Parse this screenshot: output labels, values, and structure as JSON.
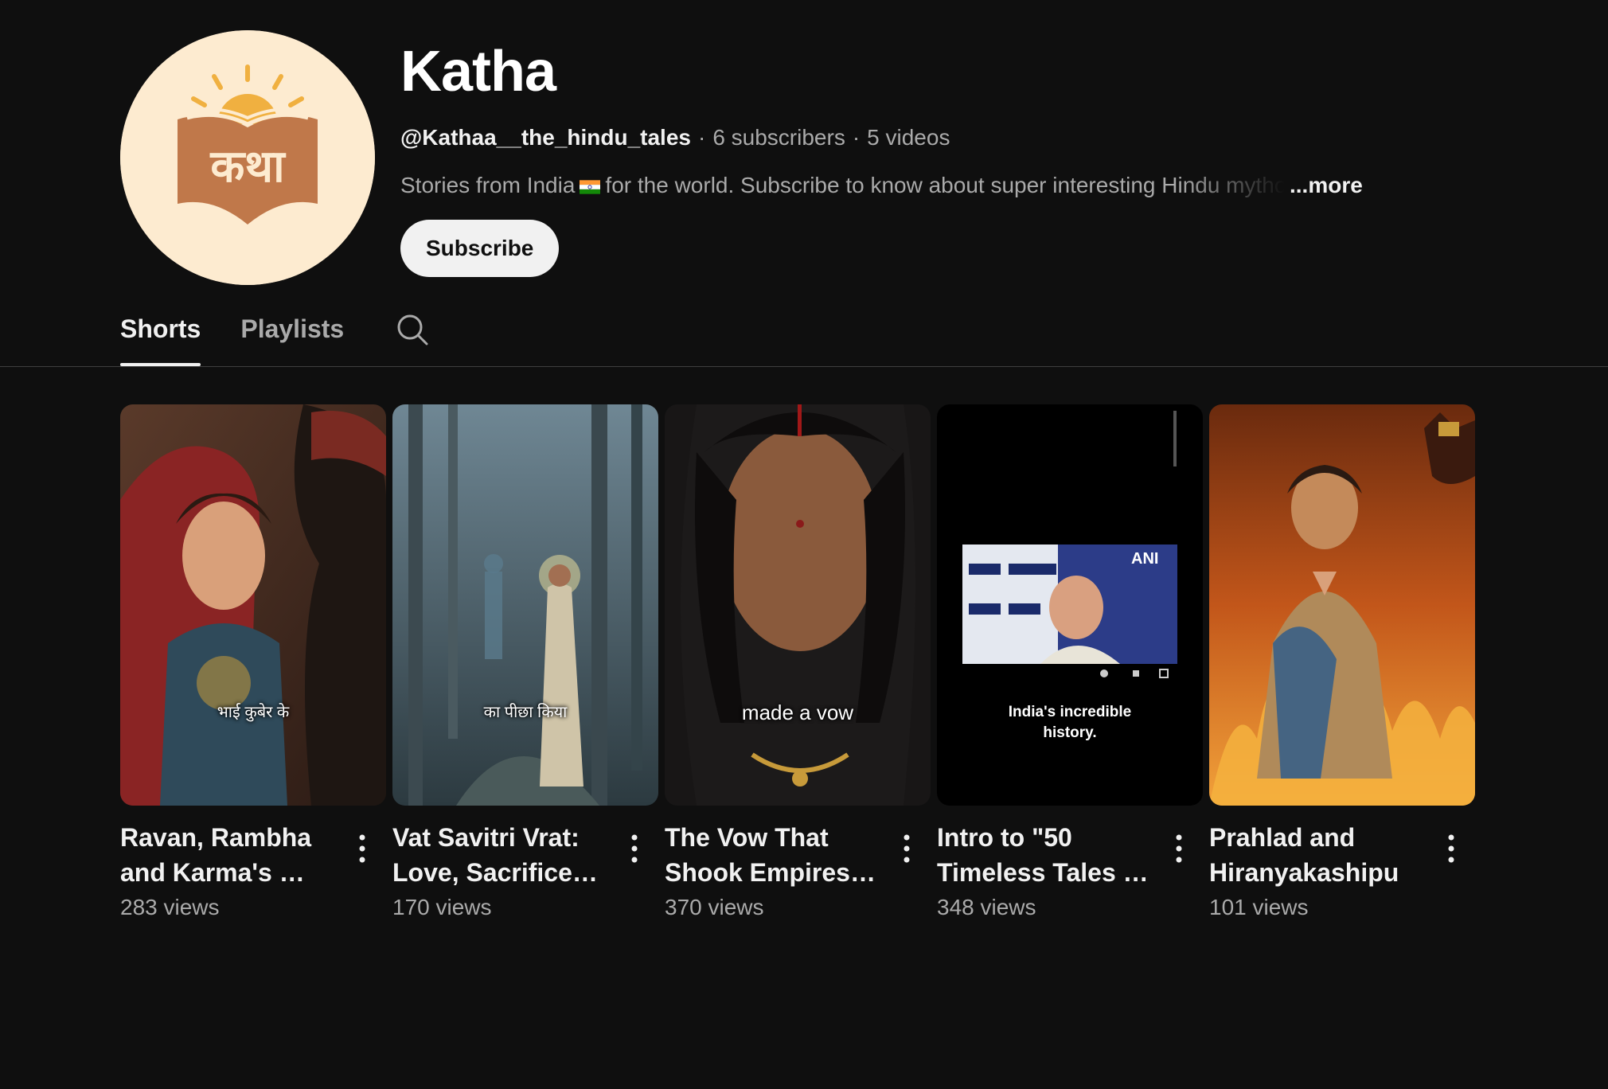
{
  "channel": {
    "title": "Katha",
    "avatar_text": "कथा",
    "handle": "@Kathaa__the_hindu_tales",
    "subscribers": "6 subscribers",
    "videos": "5 videos",
    "separator": "·",
    "description_before_flag": "Stories from India",
    "description_after_flag": "for the world. Subscribe to know about super interesting Hindu mythology",
    "more_label": "...more",
    "subscribe_label": "Subscribe",
    "flag_icon": "india-flag-icon"
  },
  "tabs": [
    {
      "label": "Shorts",
      "active": true
    },
    {
      "label": "Playlists",
      "active": false
    }
  ],
  "search_icon": "search-icon",
  "shorts": [
    {
      "title": "Ravan, Rambha and Karma's …",
      "views": "283 views",
      "overlay_text": "भाई कुबेर के"
    },
    {
      "title": "Vat Savitri Vrat: Love, Sacrifice &…",
      "views": "170 views",
      "overlay_text": "का पीछा किया"
    },
    {
      "title": "The Vow That Shook Empires: …",
      "views": "370 views",
      "overlay_text": "made a vow"
    },
    {
      "title": "Intro to \"50 Timeless Tales …",
      "views": "348 views",
      "overlay_text": "India's incredible history.",
      "inset_badge": "ANI"
    },
    {
      "title": "Prahlad and Hiranyakashipu",
      "views": "101 views",
      "overlay_text": ""
    }
  ],
  "colors": {
    "background": "#0f0f0f",
    "text_primary": "#f1f1f1",
    "text_secondary": "#aaaaaa",
    "avatar_bg": "#fdebd0",
    "logo_brown": "#c0784a",
    "logo_sun": "#f0b040"
  }
}
